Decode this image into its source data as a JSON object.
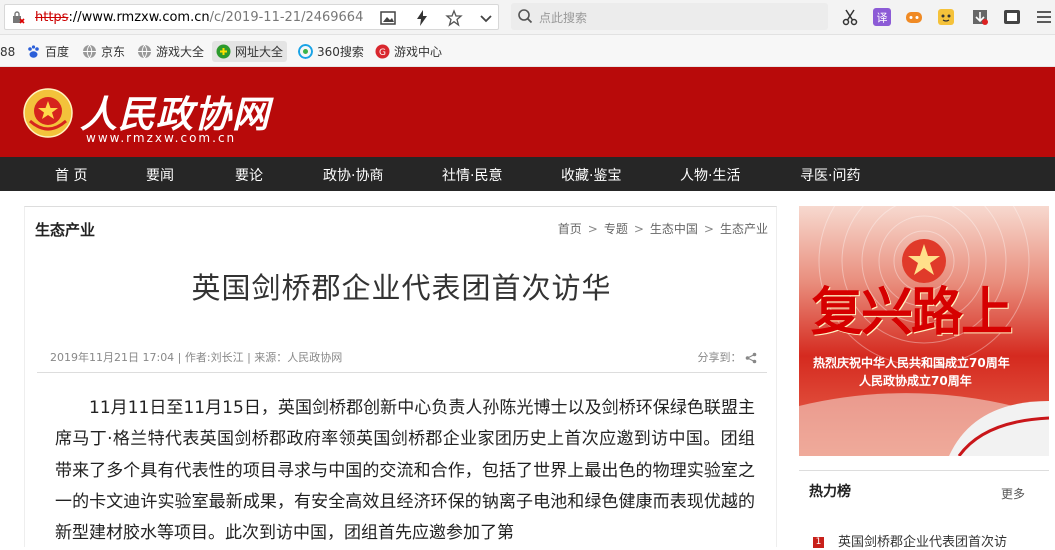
{
  "browser": {
    "url_scheme": "https",
    "url_host": "://www.rmzxw.com.cn",
    "url_path": "/c/2019-11-21/2469664",
    "search_placeholder": "点此搜索"
  },
  "bookmarks": [
    {
      "label": "88",
      "icon": "bookmark-icon"
    },
    {
      "label": "百度",
      "icon": "baidu-icon"
    },
    {
      "label": "京东",
      "icon": "globe-icon"
    },
    {
      "label": "游戏大全",
      "icon": "globe-icon"
    },
    {
      "label": "网址大全",
      "icon": "site-nav-icon"
    },
    {
      "label": "360搜索",
      "icon": "360-icon"
    },
    {
      "label": "游戏中心",
      "icon": "game-center-icon"
    }
  ],
  "site": {
    "logo_title": "人民政协网",
    "logo_sub": "www.rmzxw.com.cn",
    "brand_color": "#b80a0a"
  },
  "nav": [
    "首 页",
    "要闻",
    "要论",
    "政协·协商",
    "社情·民意",
    "收藏·鉴宝",
    "人物·生活",
    "寻医·问药"
  ],
  "article": {
    "section": "生态产业",
    "breadcrumb": [
      "首页",
      "专题",
      "生态中国",
      "生态产业"
    ],
    "title": "英国剑桥郡企业代表团首次访华",
    "meta": "2019年11月21日 17:04 | 作者:刘长江 | 来源：人民政协网",
    "share_label": "分享到：",
    "body": "11月11日至11月15日，英国剑桥郡创新中心负责人孙陈光博士以及剑桥环保绿色联盟主席马丁·格兰特代表英国剑桥郡政府率领英国剑桥郡企业家团历史上首次应邀到访中国。团组带来了多个具有代表性的项目寻求与中国的交流和合作，包括了世界上最出色的物理实验室之一的卡文迪许实验室最新成果，有安全高效且经济环保的钠离子电池和绿色健康而表现优越的新型建材胶水等项目。此次到访中国，团组首先应邀参加了第"
  },
  "sidebar": {
    "ad_title": "复兴路上",
    "ad_line1": "热烈庆祝中华人民共和国成立70周年",
    "ad_line2": "人民政协成立70周年",
    "hot_title": "热力榜",
    "hot_more": "更多",
    "hot_items": [
      {
        "rank": "1",
        "title": "英国剑桥郡企业代表团首次访"
      }
    ]
  }
}
